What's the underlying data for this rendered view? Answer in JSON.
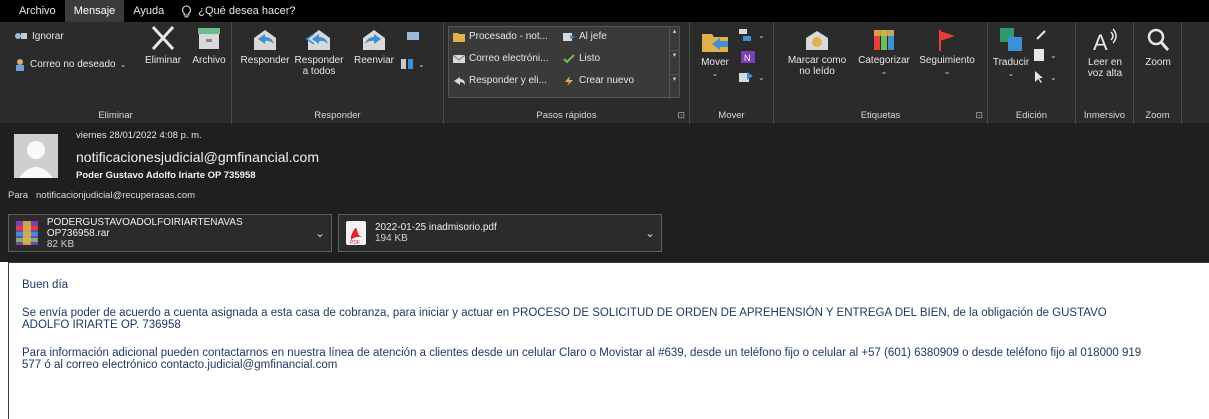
{
  "tabs": [
    {
      "label": "Archivo"
    },
    {
      "label": "Mensaje"
    },
    {
      "label": "Ayuda"
    }
  ],
  "tell_me": "¿Qué desea hacer?",
  "ribbon": {
    "eliminar": {
      "ignorar": "Ignorar",
      "correo_no_deseado": "Correo no deseado",
      "eliminar": "Eliminar",
      "archivo": "Archivo",
      "label": "Eliminar"
    },
    "responder": {
      "responder": "Responder",
      "responder_todos_1": "Responder",
      "responder_todos_2": "a todos",
      "reenviar": "Reenviar",
      "label": "Responder"
    },
    "pasos_rapidos": {
      "items": [
        "Procesado - not...",
        "Correo electróni...",
        "Responder y eli...",
        "Al jefe",
        "Listo",
        "Crear nuevo"
      ],
      "label": "Pasos rápidos"
    },
    "mover": {
      "mover": "Mover",
      "label": "Mover"
    },
    "etiquetas": {
      "marcar_1": "Marcar como",
      "marcar_2": "no leído",
      "categorizar": "Categorizar",
      "seguimiento": "Seguimiento",
      "label": "Etiquetas"
    },
    "edicion": {
      "traducir": "Traducir",
      "label": "Edición"
    },
    "inmersivo": {
      "leer_1": "Leer en",
      "leer_2": "voz alta",
      "label": "Inmersivo"
    },
    "zoom": {
      "zoom": "Zoom",
      "label": "Zoom"
    }
  },
  "message": {
    "date": "viernes 28/01/2022 4:08 p. m.",
    "from": "notificacionesjudicial@gmfinancial.com",
    "subject": "Poder Gustavo Adolfo Iriarte OP 735958",
    "to_label": "Para",
    "to": "notificacionjudicial@recuperasas.com"
  },
  "attachments": [
    {
      "name": "PODERGUSTAVOADOLFOIRIARTENAVAS OP736958.rar",
      "size": "82 KB"
    },
    {
      "name": "2022-01-25 inadmisorio.pdf",
      "size": "194 KB"
    }
  ],
  "body": {
    "greeting": "Buen día",
    "p1_line1": "Se envía poder de acuerdo a cuenta asignada a esta casa de cobranza,  para iniciar y actuar en PROCESO DE SOLICITUD DE ORDEN DE APREHENSIÓN Y ENTREGA DEL BIEN, de la obligación  de GUSTAVO",
    "p1_line2": "ADOLFO IRIARTE OP. 736958",
    "p2_line1": "Para información adicional pueden contactarnos en nuestra línea de atención a clientes desde un celular Claro o Movistar al #639, desde un teléfono fijo o celular al +57 (601) 6380909 o desde teléfono fijo al 018000 919",
    "p2_line2": "577 ó al correo electrónico contacto.judicial@gmfinancial.com"
  },
  "colors": {
    "ribbon_bg": "#2b2b2b",
    "tabbar_bg": "#000000",
    "header_bg": "#1f1f1f",
    "body_text": "#1f3864",
    "accent_blue": "#3d8fd6",
    "flag_red": "#e0413a"
  }
}
